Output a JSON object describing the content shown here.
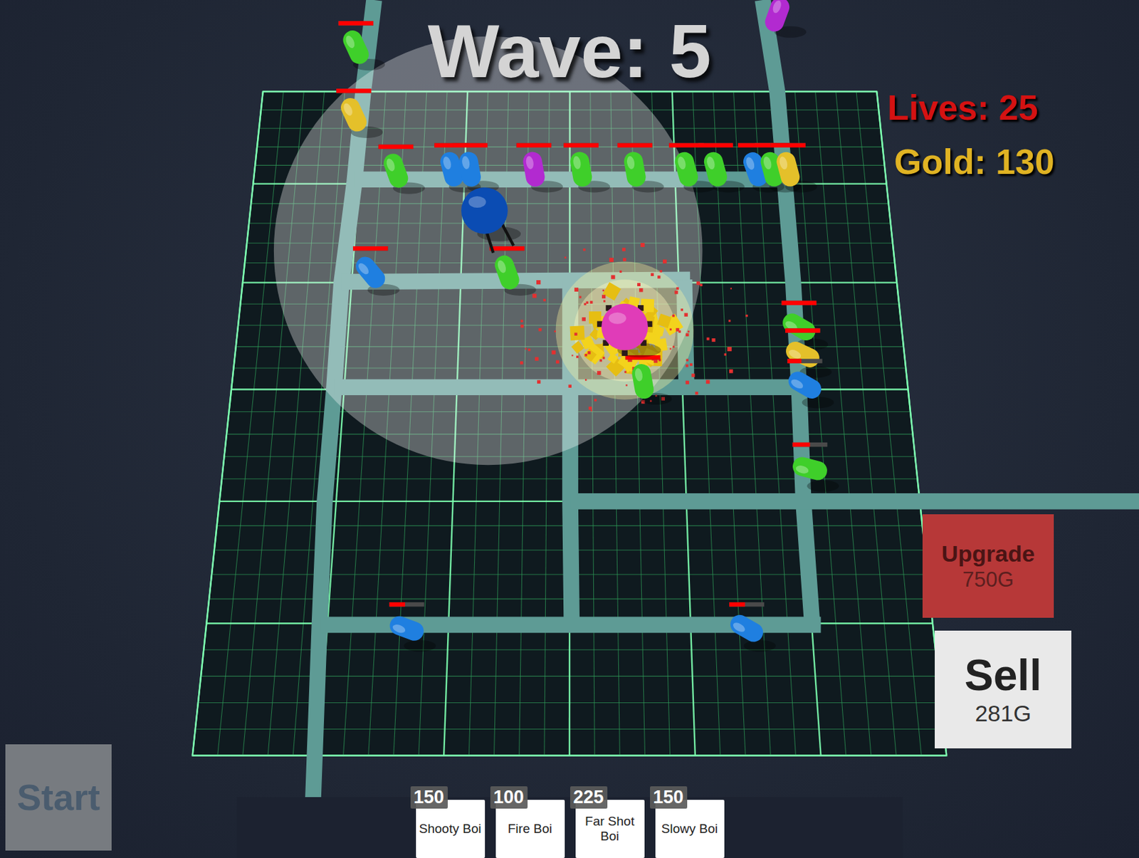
{
  "hud": {
    "wave": "Wave: 5",
    "lives": "Lives: 25",
    "gold": "Gold: 130"
  },
  "selection": {
    "upgrade": {
      "label": "Upgrade",
      "cost": "750G"
    },
    "sell": {
      "label": "Sell",
      "value": "281G"
    }
  },
  "start_button": {
    "label": "Start",
    "disabled": true
  },
  "shop": [
    {
      "price": "150",
      "label": "Shooty Boi"
    },
    {
      "price": "100",
      "label": "Fire Boi"
    },
    {
      "price": "225",
      "label": "Far Shot Boi"
    },
    {
      "price": "150",
      "label": "Slowy Boi"
    }
  ],
  "towers": [
    {
      "kind": "shooty",
      "color": "#0b4cb3",
      "selected": true,
      "firing": false
    },
    {
      "kind": "fire",
      "color": "#e03cb8",
      "selected": false,
      "firing": true
    }
  ],
  "enemies": [
    {
      "color": "#3fcf2a",
      "health": 1
    },
    {
      "color": "#e4c02a",
      "health": 1
    },
    {
      "color": "#3fcf2a",
      "health": 1
    },
    {
      "color": "#1f7fe0",
      "health": 1
    },
    {
      "color": "#1f7fe0",
      "health": 1
    },
    {
      "color": "#b22ad0",
      "health": 1
    },
    {
      "color": "#3fcf2a",
      "health": 1
    },
    {
      "color": "#3fcf2a",
      "health": 1
    },
    {
      "color": "#3fcf2a",
      "health": 1
    },
    {
      "color": "#3fcf2a",
      "health": 1
    },
    {
      "color": "#1f7fe0",
      "health": 1
    },
    {
      "color": "#3fcf2a",
      "health": 1
    },
    {
      "color": "#e4c02a",
      "health": 1
    },
    {
      "color": "#1f7fe0",
      "health": 1
    },
    {
      "color": "#3fcf2a",
      "health": 1
    },
    {
      "color": "#3fcf2a",
      "health": 1
    },
    {
      "color": "#3fcf2a",
      "health": 1
    },
    {
      "color": "#e4c02a",
      "health": 1
    },
    {
      "color": "#1f7fe0",
      "health": 0.4
    },
    {
      "color": "#3fcf2a",
      "health": 0.5
    },
    {
      "color": "#1f7fe0",
      "health": 0.45
    },
    {
      "color": "#1f7fe0",
      "health": 0.45
    },
    {
      "color": "#b22ad0"
    }
  ]
}
